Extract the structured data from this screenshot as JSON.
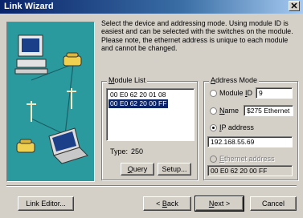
{
  "window": {
    "title": "Link Wizard",
    "close_glyph": "✕"
  },
  "description": "Select the device and addressing mode. Using module ID is easiest and can be selected with the switches on the module. Please note, the ethernet address is unique to each module and cannot be changed.",
  "module_list": {
    "label_u": "M",
    "label_rest": "odule List",
    "items": [
      {
        "text": "00 E0 62 20 01 08",
        "selected": false
      },
      {
        "text": "00 E0 62 20 00 FF",
        "selected": true
      }
    ],
    "type_label": "Type:",
    "type_value": "250",
    "query_u": "Q",
    "query_rest": "uery",
    "setup_label": "Setup..."
  },
  "address_mode": {
    "label_u": "A",
    "label_rest": "ddress Mode",
    "module_id": {
      "pre": "Module ",
      "u": "I",
      "post": "D",
      "value": "9",
      "selected": false
    },
    "name": {
      "u": "N",
      "rest": "ame",
      "value": "$275 Ethernet",
      "selected": false
    },
    "ip": {
      "u": "I",
      "rest": "P address",
      "value": "192.168.55.69",
      "selected": true
    },
    "ethernet": {
      "u": "E",
      "rest": "thernet address",
      "value": "00 E0 62 20 00 FF",
      "selected": false,
      "enabled": false
    }
  },
  "buttons": {
    "link_editor": "Link Editor...",
    "back_prefix": "< ",
    "back_u": "B",
    "back_rest": "ack",
    "next_u": "N",
    "next_rest": "ext >",
    "cancel": "Cancel"
  },
  "icons": [
    "computer-icon",
    "network-pole-icon",
    "laptop-icon",
    "telephone-icon"
  ]
}
